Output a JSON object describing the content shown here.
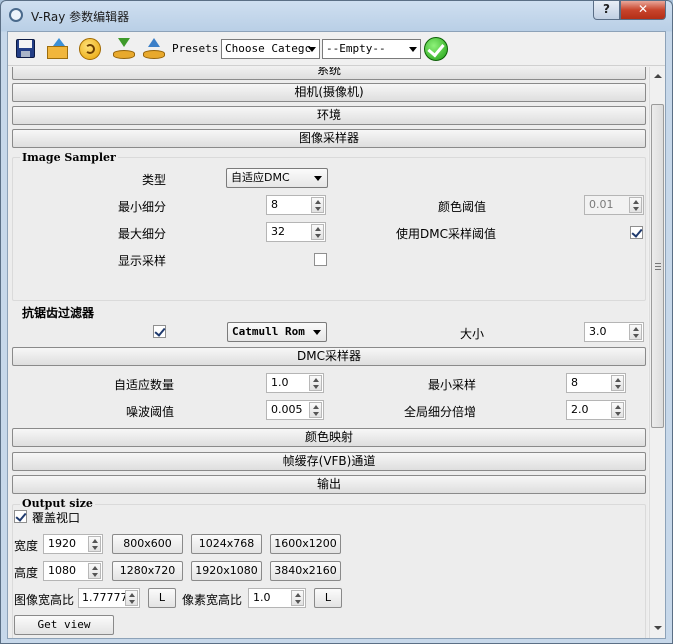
{
  "window": {
    "title": "V-Ray 参数编辑器",
    "help_label": "?",
    "close_label": "✕"
  },
  "toolbar": {
    "icons": [
      "save-icon",
      "open-folder-icon",
      "reset-icon",
      "download-preset-icon",
      "upload-preset-icon",
      "apply-check-icon"
    ],
    "presets_label": "Presets:",
    "category_value": "Choose Categc",
    "preset_value": "--Empty--"
  },
  "sections": {
    "system": "系统",
    "camera": "相机(摄像机)",
    "environment": "环境",
    "image_sampler": "图像采样器",
    "dmc_sampler": "DMC采样器",
    "color_mapping": "颜色映射",
    "vfb_channels": "帧缓存(VFB)通道",
    "output": "输出"
  },
  "image_sampler": {
    "group_title": "Image Sampler",
    "type_label": "类型",
    "type_value": "自适应DMC",
    "min_subdiv_label": "最小细分",
    "min_subdiv_value": "8",
    "max_subdiv_label": "最大细分",
    "max_subdiv_value": "32",
    "show_samples_label": "显示采样",
    "show_samples_checked": false,
    "color_threshold_label": "颜色阈值",
    "color_threshold_value": "0.01",
    "use_dmc_threshold_label": "使用DMC采样阈值",
    "use_dmc_threshold_checked": true
  },
  "antialiasing": {
    "group_title": "抗锯齿过滤器",
    "enabled": true,
    "filter_value": "Catmull Rom",
    "size_label": "大小",
    "size_value": "3.0"
  },
  "dmc": {
    "adaptive_amount_label": "自适应数量",
    "adaptive_amount_value": "1.0",
    "noise_threshold_label": "噪波阈值",
    "noise_threshold_value": "0.005",
    "min_samples_label": "最小采样",
    "min_samples_value": "8",
    "global_subdiv_label": "全局细分倍增",
    "global_subdiv_value": "2.0"
  },
  "output": {
    "group_title": "Output size",
    "override_viewport_label": "覆盖视口",
    "override_viewport_checked": true,
    "width_label": "宽度",
    "width_value": "1920",
    "height_label": "高度",
    "height_value": "1080",
    "presets_row1": [
      "800x600",
      "1024x768",
      "1600x1200"
    ],
    "presets_row2": [
      "1280x720",
      "1920x1080",
      "3840x2160"
    ],
    "image_aspect_label": "图像宽高比",
    "image_aspect_value": "1.77777",
    "lock_label": "L",
    "pixel_aspect_label": "像素宽高比",
    "pixel_aspect_value": "1.0",
    "get_view_aspect_label": "Get view aspect"
  }
}
